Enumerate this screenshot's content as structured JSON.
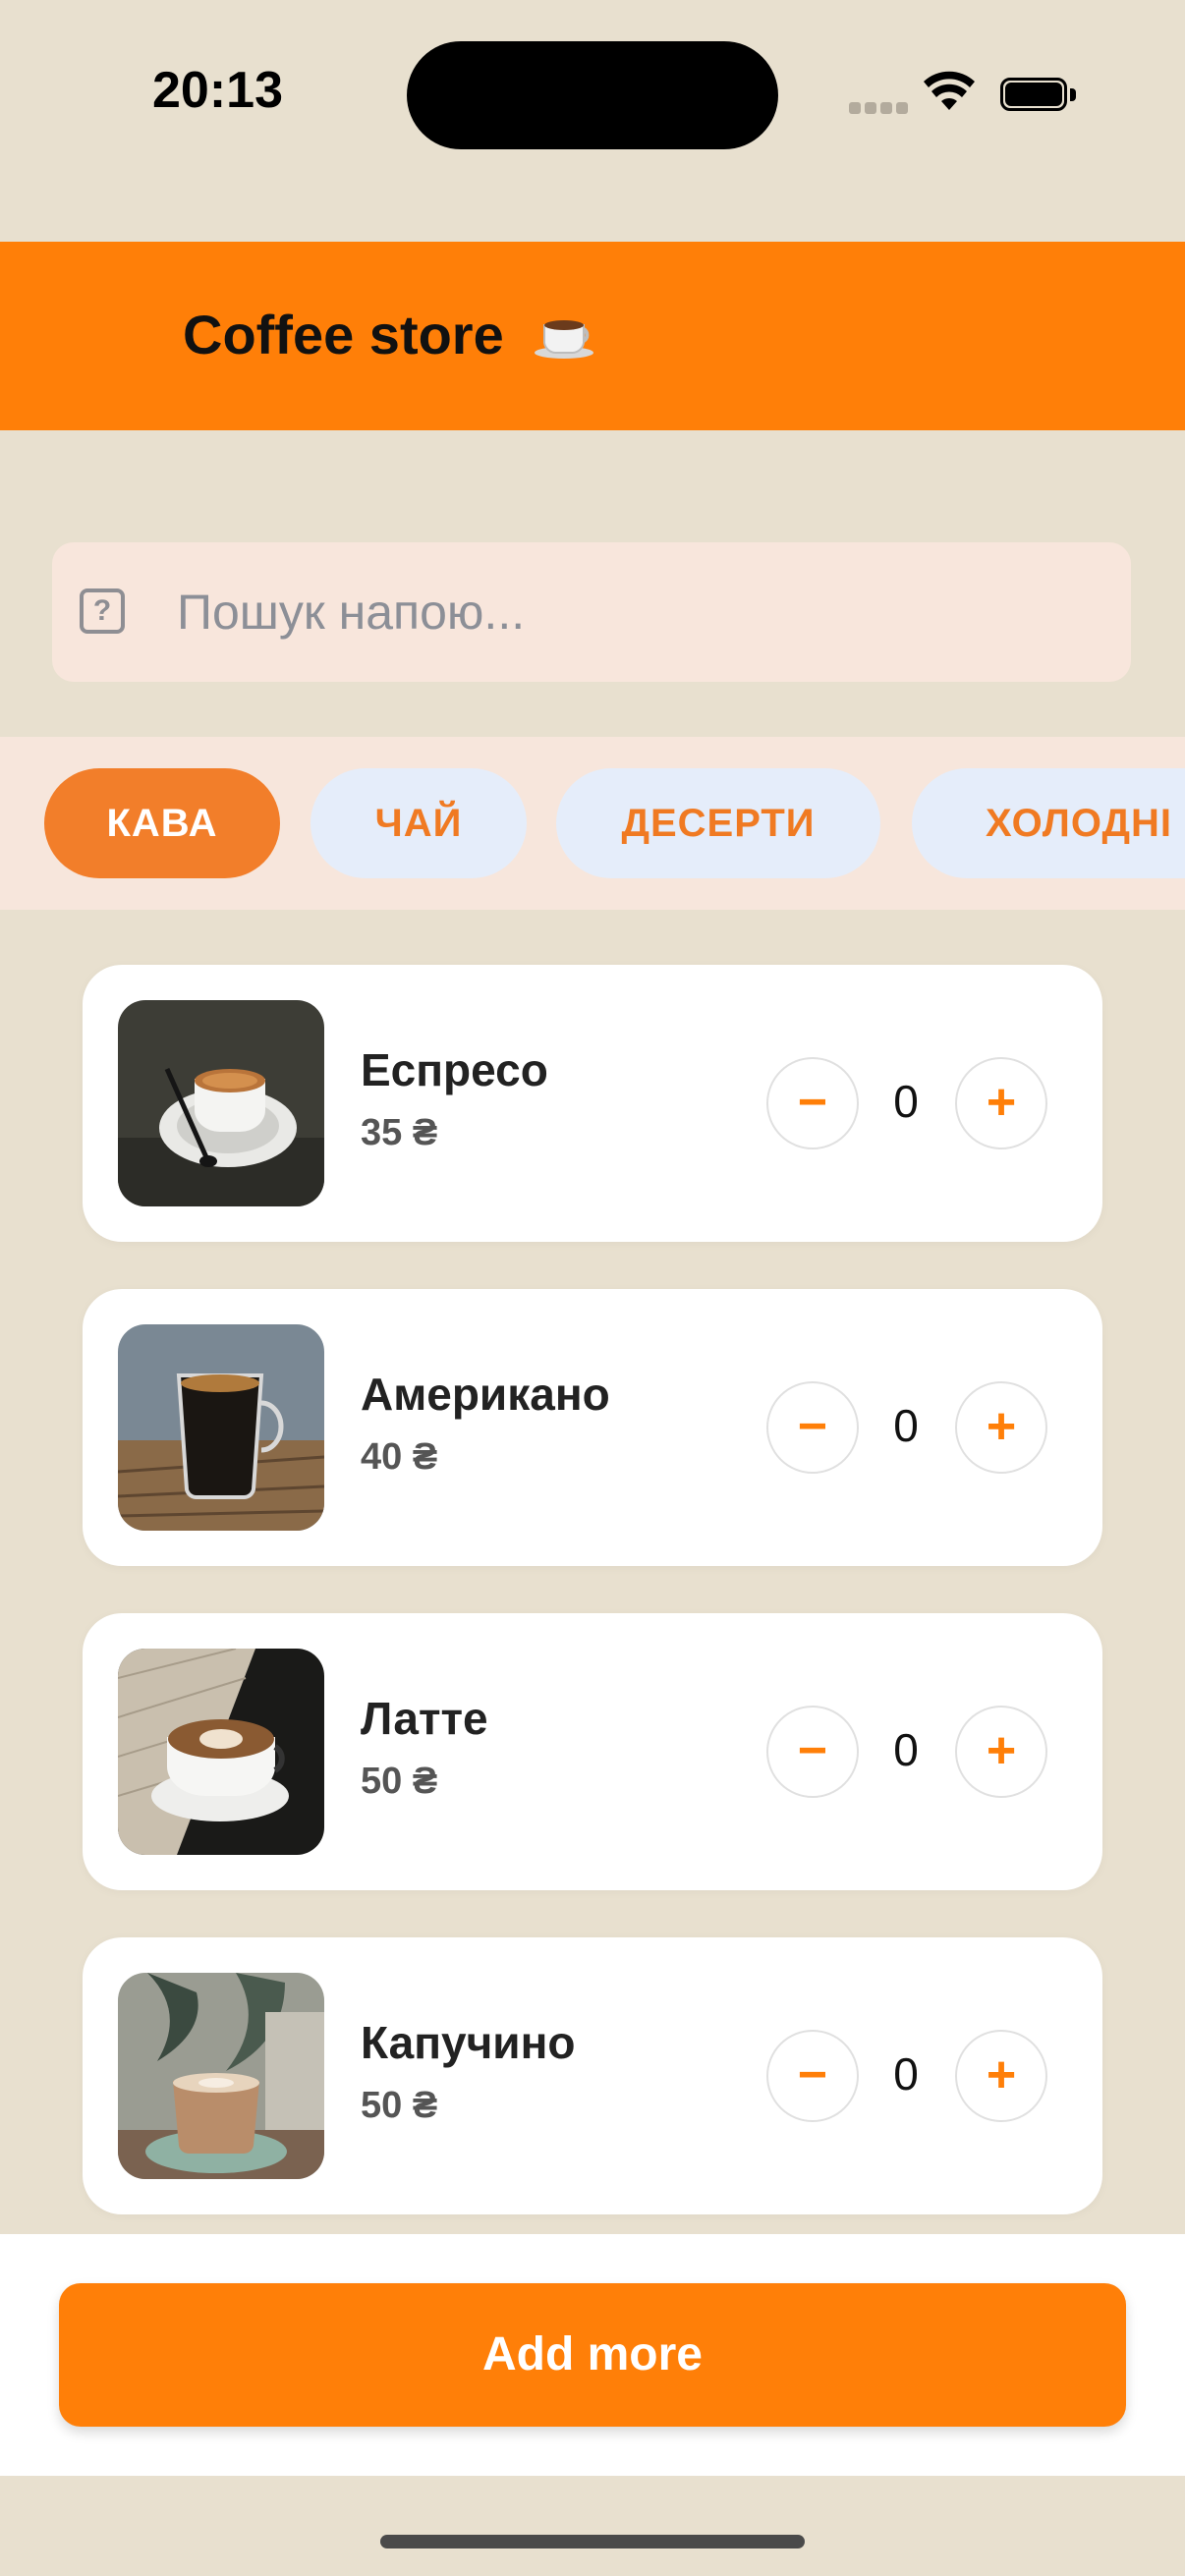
{
  "status_bar": {
    "time": "20:13"
  },
  "header": {
    "title": "Coffee store",
    "title_icon": "coffee-cup-emoji"
  },
  "search": {
    "placeholder": "Пошук напою...",
    "value": "",
    "icon": "question-box-icon"
  },
  "tabs": [
    {
      "label": "КАВА",
      "active": true
    },
    {
      "label": "ЧАЙ",
      "active": false
    },
    {
      "label": "ДЕСЕРТИ",
      "active": false
    },
    {
      "label": "ХОЛОДНІ",
      "active": false
    }
  ],
  "products": [
    {
      "name": "Еспресо",
      "price": "35 ₴",
      "quantity": "0",
      "image": "espresso-photo"
    },
    {
      "name": "Американо",
      "price": "40 ₴",
      "quantity": "0",
      "image": "americano-photo"
    },
    {
      "name": "Латте",
      "price": "50 ₴",
      "quantity": "0",
      "image": "latte-photo"
    },
    {
      "name": "Капучино",
      "price": "50 ₴",
      "quantity": "0",
      "image": "cappuccino-photo"
    }
  ],
  "stepper": {
    "minus_label": "−",
    "plus_label": "+"
  },
  "bottom": {
    "add_more_label": "Add more"
  },
  "colors": {
    "accent": "#ff7f08",
    "background": "#e8e0cf",
    "tab_active": "#f27e2a",
    "tab_inactive": "#e5edfa"
  }
}
